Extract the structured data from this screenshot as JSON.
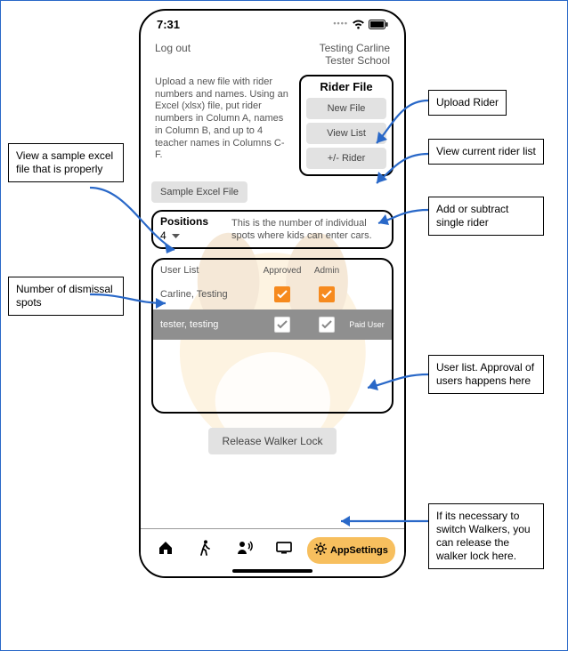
{
  "statusbar": {
    "time": "7:31"
  },
  "header": {
    "logout": "Log out",
    "school_line1": "Testing Carline",
    "school_line2": "Tester School"
  },
  "upload_text": "Upload a new file with rider numbers and names.  Using an Excel (xlsx) file, put rider numbers in Column A, names in Column B, and up to 4 teacher names in Columns C-F.",
  "rider_file": {
    "title": "Rider File",
    "new_file": "New File",
    "view_list": "View List",
    "plus_minus": "+/- Rider"
  },
  "sample_btn": "Sample Excel File",
  "positions": {
    "title": "Positions",
    "value": "4",
    "desc": "This is the number of individual spots where kids can enter cars."
  },
  "userlist": {
    "title": "User List",
    "col_approved": "Approved",
    "col_admin": "Admin",
    "rows": [
      {
        "name": "Carline, Testing",
        "approved": true,
        "admin": true,
        "paid": ""
      },
      {
        "name": "tester, testing",
        "approved": true,
        "admin": true,
        "paid": "Paid User"
      }
    ]
  },
  "release_btn": "Release Walker Lock",
  "tabbar": {
    "settings": "AppSettings"
  },
  "annotations": {
    "sample": "View a sample excel file that is properly",
    "positions": "Number of dismissal spots",
    "upload": "Upload Rider",
    "viewlist": "View current rider list",
    "plusminus": "Add or subtract single rider",
    "userlist": "User list. Approval of users happens here",
    "release": "If its necessary to switch Walkers, you can release the walker lock here."
  }
}
